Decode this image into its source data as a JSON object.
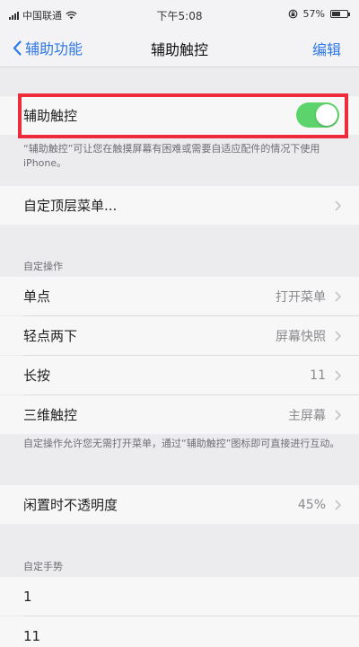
{
  "status_bar": {
    "carrier": "中国联通",
    "time": "下午5:08",
    "battery": "57%",
    "battery_level": 0.57
  },
  "nav": {
    "back_label": "辅助功能",
    "title": "辅助触控",
    "edit_label": "编辑"
  },
  "assistive_touch": {
    "label": "辅助触控",
    "enabled": true,
    "description": "“辅助触控”可让您在触摸屏幕有困难或需要自适应配件的情况下使用 iPhone。"
  },
  "top_menu": {
    "label": "自定顶层菜单..."
  },
  "custom_actions": {
    "header": "自定操作",
    "items": [
      {
        "label": "单点",
        "value": "打开菜单"
      },
      {
        "label": "轻点两下",
        "value": "屏幕快照"
      },
      {
        "label": "长按",
        "value": "11"
      },
      {
        "label": "三维触控",
        "value": "主屏幕"
      }
    ],
    "footnote": "自定操作允许您无需打开菜单，通过“辅助触控”图标即可直接进行互动。"
  },
  "idle_opacity": {
    "label": "闲置时不透明度",
    "value": "45%"
  },
  "custom_gestures": {
    "header": "自定手势",
    "items": [
      {
        "label": "1"
      },
      {
        "label": "11"
      }
    ]
  },
  "colors": {
    "accent": "#2f78e8",
    "toggle_on": "#5cd46b",
    "highlight": "#ee2b3a"
  }
}
